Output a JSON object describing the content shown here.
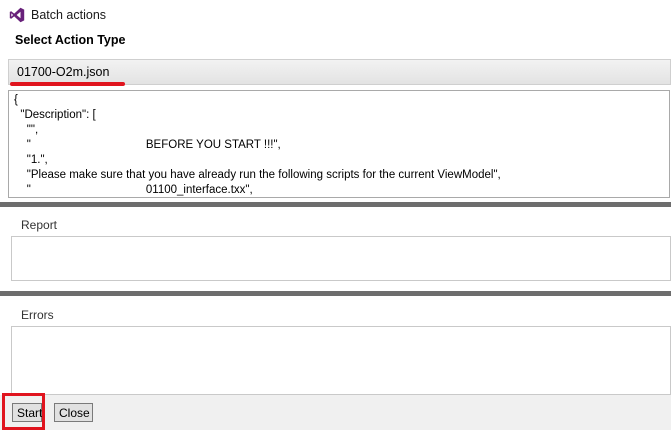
{
  "window": {
    "title": "Batch actions"
  },
  "action_type": {
    "heading": "Select Action Type",
    "selected": "01700-O2m.json"
  },
  "json_preview": {
    "lines": [
      "{",
      "  \"Description\": [",
      "    \"\",",
      "    \"                                    BEFORE YOU START !!!\",",
      "    \"1.\",",
      "    \"Please make sure that you have already run the following scripts for the current ViewModel\",",
      "    \"                                    01100_interface.txx\","
    ]
  },
  "report": {
    "label": "Report",
    "content": ""
  },
  "errors": {
    "label": "Errors",
    "content": ""
  },
  "buttons": {
    "start": "Start",
    "close": "Close"
  },
  "colors": {
    "highlight": "#e0141e",
    "splitter": "#6d6d6d",
    "vs_purple": "#68217a"
  }
}
